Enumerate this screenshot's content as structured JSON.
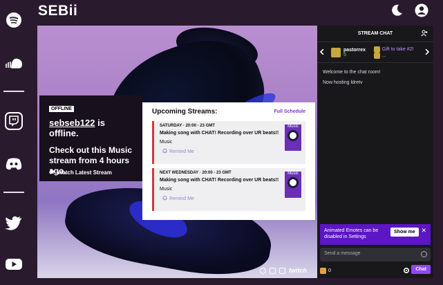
{
  "brand": "SEBii",
  "header": {
    "theme_icon": "moon-icon",
    "account_icon": "account-icon"
  },
  "rail": {
    "items": [
      {
        "name": "spotify-icon"
      },
      {
        "name": "soundcloud-icon"
      },
      {
        "name": "twitch-icon"
      },
      {
        "name": "discord-icon"
      },
      {
        "name": "twitter-icon"
      },
      {
        "name": "youtube-icon"
      }
    ]
  },
  "offline": {
    "badge": "OFFLINE",
    "username": "sebseb122",
    "status_suffix": " is offline.",
    "message": "Check out this Music stream from 4 hours ago.",
    "watch_label": "Watch Latest Stream"
  },
  "upcoming": {
    "title": "Upcoming Streams:",
    "schedule_link": "Full Schedule",
    "streams": [
      {
        "day": "SATURDAY",
        "time": "20:00 - 23 GMT",
        "title": "Making song with CHAT! Recording over UR beats!!",
        "category": "Music",
        "remind": "Remind Me",
        "thumb_label": "Music"
      },
      {
        "day": "NEXT WEDNESDAY",
        "time": "20:00 - 23 GMT",
        "title": "Making song with CHAT! Recording over UR beats!!",
        "category": "Music",
        "remind": "Remind Me",
        "thumb_label": "Music"
      }
    ]
  },
  "player": {
    "logo": "twitch"
  },
  "chat": {
    "title": "STREAM CHAT",
    "gifter": {
      "name": "pastorrex",
      "count": "5"
    },
    "gift_promo": "Gift to take #2!",
    "gift_sub": "...",
    "messages": [
      "Welcome to the chat room!",
      "Now hosting ldretv"
    ],
    "promo_text": "Animated Emotes can be disabled in Settings",
    "promo_button": "Show me",
    "send_placeholder": "Send a message",
    "points": "0",
    "chat_button": "Chat"
  },
  "colors": {
    "accent": "#9147ff",
    "promo": "#5c16c5",
    "offline_bar": "#d83636",
    "background": "#2a1a2e"
  }
}
